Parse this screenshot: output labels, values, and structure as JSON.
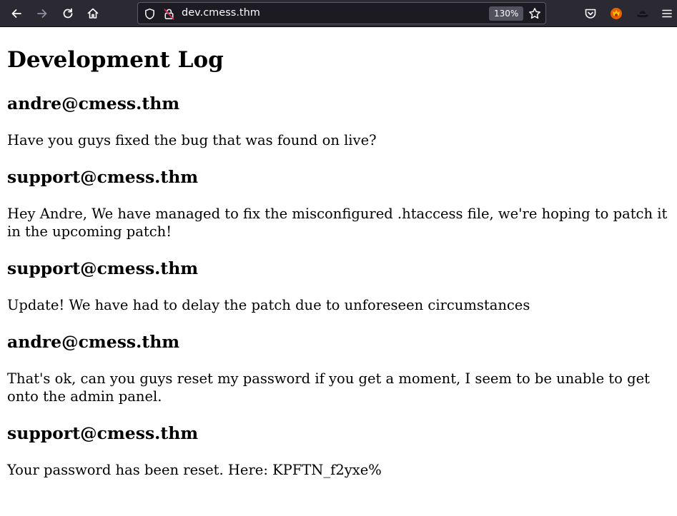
{
  "browser": {
    "url": "dev.cmess.thm",
    "zoom": "130%",
    "icons": {
      "back": "arrow-left-icon",
      "forward": "arrow-right-icon",
      "reload": "reload-icon",
      "home": "home-icon",
      "shield": "shield-icon",
      "insecure": "insecure-lock-icon",
      "bookmark": "star-icon",
      "pocket": "pocket-icon",
      "extension1": "fox-extension-icon",
      "extension2": "hat-extension-icon",
      "menu": "hamburger-menu-icon"
    }
  },
  "page": {
    "title": "Development Log",
    "entries": [
      {
        "author": "andre@cmess.thm",
        "message": "Have you guys fixed the bug that was found on live?"
      },
      {
        "author": "support@cmess.thm",
        "message": "Hey Andre, We have managed to fix the misconfigured .htaccess file, we're hoping to patch it in the upcoming patch!"
      },
      {
        "author": "support@cmess.thm",
        "message": "Update! We have had to delay the patch due to unforeseen circumstances"
      },
      {
        "author": "andre@cmess.thm",
        "message": "That's ok, can you guys reset my password if you get a moment, I seem to be unable to get onto the admin panel."
      },
      {
        "author": "support@cmess.thm",
        "message": "Your password has been reset. Here: KPFTN_f2yxe%"
      }
    ]
  }
}
